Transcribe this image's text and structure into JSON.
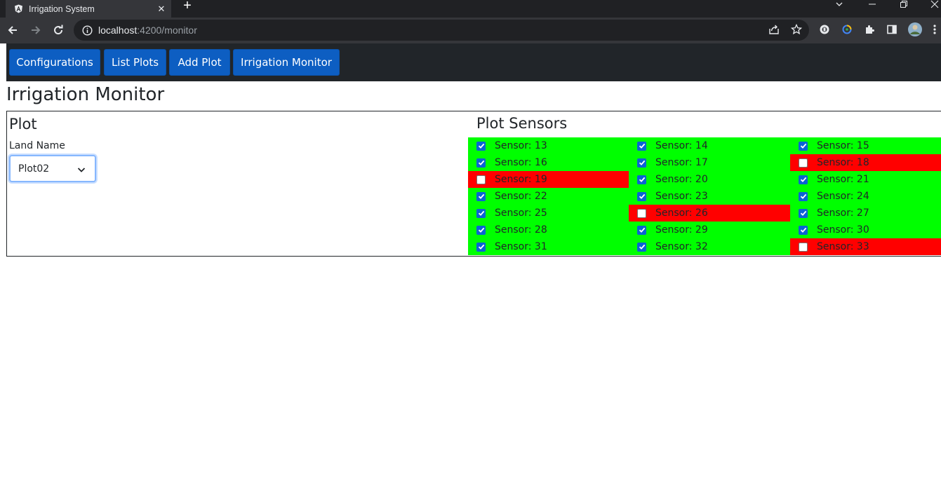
{
  "browser": {
    "tab_title": "Irrigation System",
    "tab_close": "✕",
    "new_tab": "+",
    "url_host": "localhost",
    "url_path": ":4200/monitor"
  },
  "nav": {
    "buttons": [
      "Configurations",
      "List Plots",
      "Add Plot",
      "Irrigation Monitor"
    ]
  },
  "page": {
    "title": "Irrigation Monitor",
    "plot_heading": "Plot",
    "land_label": "Land Name",
    "land_selected": "Plot02",
    "sensors_heading": "Plot Sensors"
  },
  "sensors": [
    {
      "label": "Sensor: 13",
      "active": true
    },
    {
      "label": "Sensor: 14",
      "active": true
    },
    {
      "label": "Sensor: 15",
      "active": true
    },
    {
      "label": "Sensor: 16",
      "active": true
    },
    {
      "label": "Sensor: 17",
      "active": true
    },
    {
      "label": "Sensor: 18",
      "active": false
    },
    {
      "label": "Sensor: 19",
      "active": false
    },
    {
      "label": "Sensor: 20",
      "active": true
    },
    {
      "label": "Sensor: 21",
      "active": true
    },
    {
      "label": "Sensor: 22",
      "active": true
    },
    {
      "label": "Sensor: 23",
      "active": true
    },
    {
      "label": "Sensor: 24",
      "active": true
    },
    {
      "label": "Sensor: 25",
      "active": true
    },
    {
      "label": "Sensor: 26",
      "active": false
    },
    {
      "label": "Sensor: 27",
      "active": true
    },
    {
      "label": "Sensor: 28",
      "active": true
    },
    {
      "label": "Sensor: 29",
      "active": true
    },
    {
      "label": "Sensor: 30",
      "active": true
    },
    {
      "label": "Sensor: 31",
      "active": true
    },
    {
      "label": "Sensor: 32",
      "active": true
    },
    {
      "label": "Sensor: 33",
      "active": false
    }
  ],
  "colors": {
    "sensor_ok": "#00ff00",
    "sensor_off": "#ff0000",
    "nav_button": "#0d5ec2",
    "nav_bar": "#212529"
  }
}
